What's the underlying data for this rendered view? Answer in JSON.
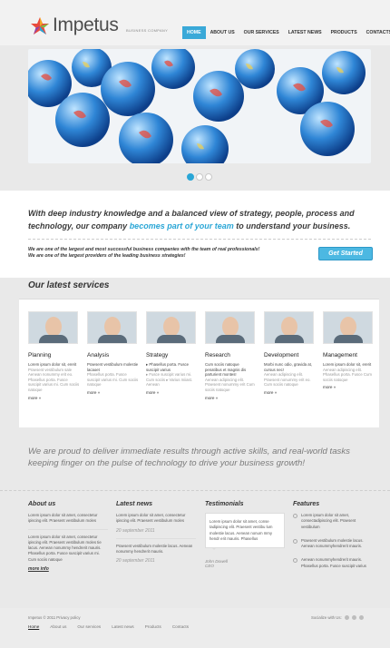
{
  "brand": {
    "name": "Impetus",
    "tagline": "BUSINESS COMPANY"
  },
  "nav": [
    {
      "label": "HOME",
      "active": true
    },
    {
      "label": "ABOUT US"
    },
    {
      "label": "OUR SERVICES"
    },
    {
      "label": "LATEST NEWS"
    },
    {
      "label": "PRODUCTS"
    },
    {
      "label": "CONTACTS"
    }
  ],
  "slider": {
    "slides": 3,
    "active": 1
  },
  "intro": {
    "part1": "With deep industry knowledge and a balanced view of strategy, people, process and technology, our company ",
    "highlight": "becomes part of your team",
    "part2": " to understand your business."
  },
  "tagline": {
    "line1": "We are one of the largest and most successful business companies with the team of real professionals!",
    "line2": "We are one of the largest providers of the leading business strategies!"
  },
  "cta": {
    "label": "Get Started"
  },
  "services": {
    "title": "Our latest services",
    "items": [
      {
        "title": "Planning",
        "t1": "Lorem ipsum dolor sit, ererit",
        "t2": "Praesent vestibulum sale Aenean nonummy erit eo. Phasellus porta. Fusce suscipit varius mi. Cum sociis natoque",
        "more": "more »"
      },
      {
        "title": "Analysis",
        "t1": "Praesent vestibulum molestie lacaoet",
        "t2": "Phasellus porta. Fusce suscipit varius mi. Cum sociis natoque",
        "more": "more »"
      },
      {
        "title": "Strategy",
        "t1": "▸ Phasellus porta. Fusce suscipit varius",
        "t2": "▸ Fusce suscipit varius mi. Cum sociis ▸ Varius miiast. Aenean",
        "more": "more »"
      },
      {
        "title": "Research",
        "t1": "Cum sociis natoque penatibus et magnis dis parturient montes!",
        "t2": "Aenean adipiscing elit. Praesent nonummy erit Cum sociis natoque",
        "more": "more »"
      },
      {
        "title": "Development",
        "t1": "Morbi nunc odio, gravida at, cursus nec!",
        "t2": "Aenean adipiscing elit. Praesent nonummy erit eo. Cum sociis natoque",
        "more": "more »"
      },
      {
        "title": "Management",
        "t1": "Lorem ipsum dolor sit, ererit",
        "t2": "Aenean adipiscing elit. Phasellus porta. Fusce Cum sociis natoque",
        "more": "more »"
      }
    ]
  },
  "quote": "We are proud to deliver immediate results through active skills, and real-world tasks keeping finger on the pulse of technology to drive your business growth!",
  "about": {
    "title": "About us",
    "p1": "Lorem ipsum dolor sit amet, consectetur ipiscing elit. Praesent vestibulum moles",
    "p2": "Lorem ipsum dolor sit amet, consectetur ipiscing elit. Praesent vestibulum moles tie lacus. Aenean nonummy hendrerit mauris. Phasellus porta. Fusce suscipit varius mi. Cum sociis natoque",
    "more": "more info"
  },
  "news": {
    "title": "Latest news",
    "items": [
      {
        "text": "Lorem ipsum dolor sit amet, consectetur ipiscing elit. Praesent vestibulum moles",
        "date": "20 september 2011"
      },
      {
        "text": "Praesent vestibulum molestie lacus. Aenean nonummy hendrerit mauris.",
        "date": "20 september 2011"
      }
    ]
  },
  "testimonials": {
    "title": "Testimonials",
    "text": "Lorem ipsum dolor sit amet, conse tadipiscing elit. Praesent vestibu lum molestie lacus. Aenean nonum mmy hendr erit mauris. Phasellus",
    "author": "John Dowell",
    "role": "CEO"
  },
  "features": {
    "title": "Features",
    "items": [
      "Lorem ipsum dolor sit amet, consectadipiscing elit. Praesent vestibulum",
      "Praesent vestibulum molestie lacus. Aenean nonummyhendrerit mauris.",
      "Aenean nonummyhendrerit mauris. Phasellus porta. Fusce suscipit varius"
    ]
  },
  "footer": {
    "copyright": "Impetus © 2011 Privacy policy",
    "social": "Socialize with Us:",
    "links": [
      "Home",
      "About us",
      "Our services",
      "Latest news",
      "Products",
      "Contacts"
    ]
  },
  "colors": {
    "accent": "#2aa6d6",
    "button": "#4cb8e2"
  }
}
